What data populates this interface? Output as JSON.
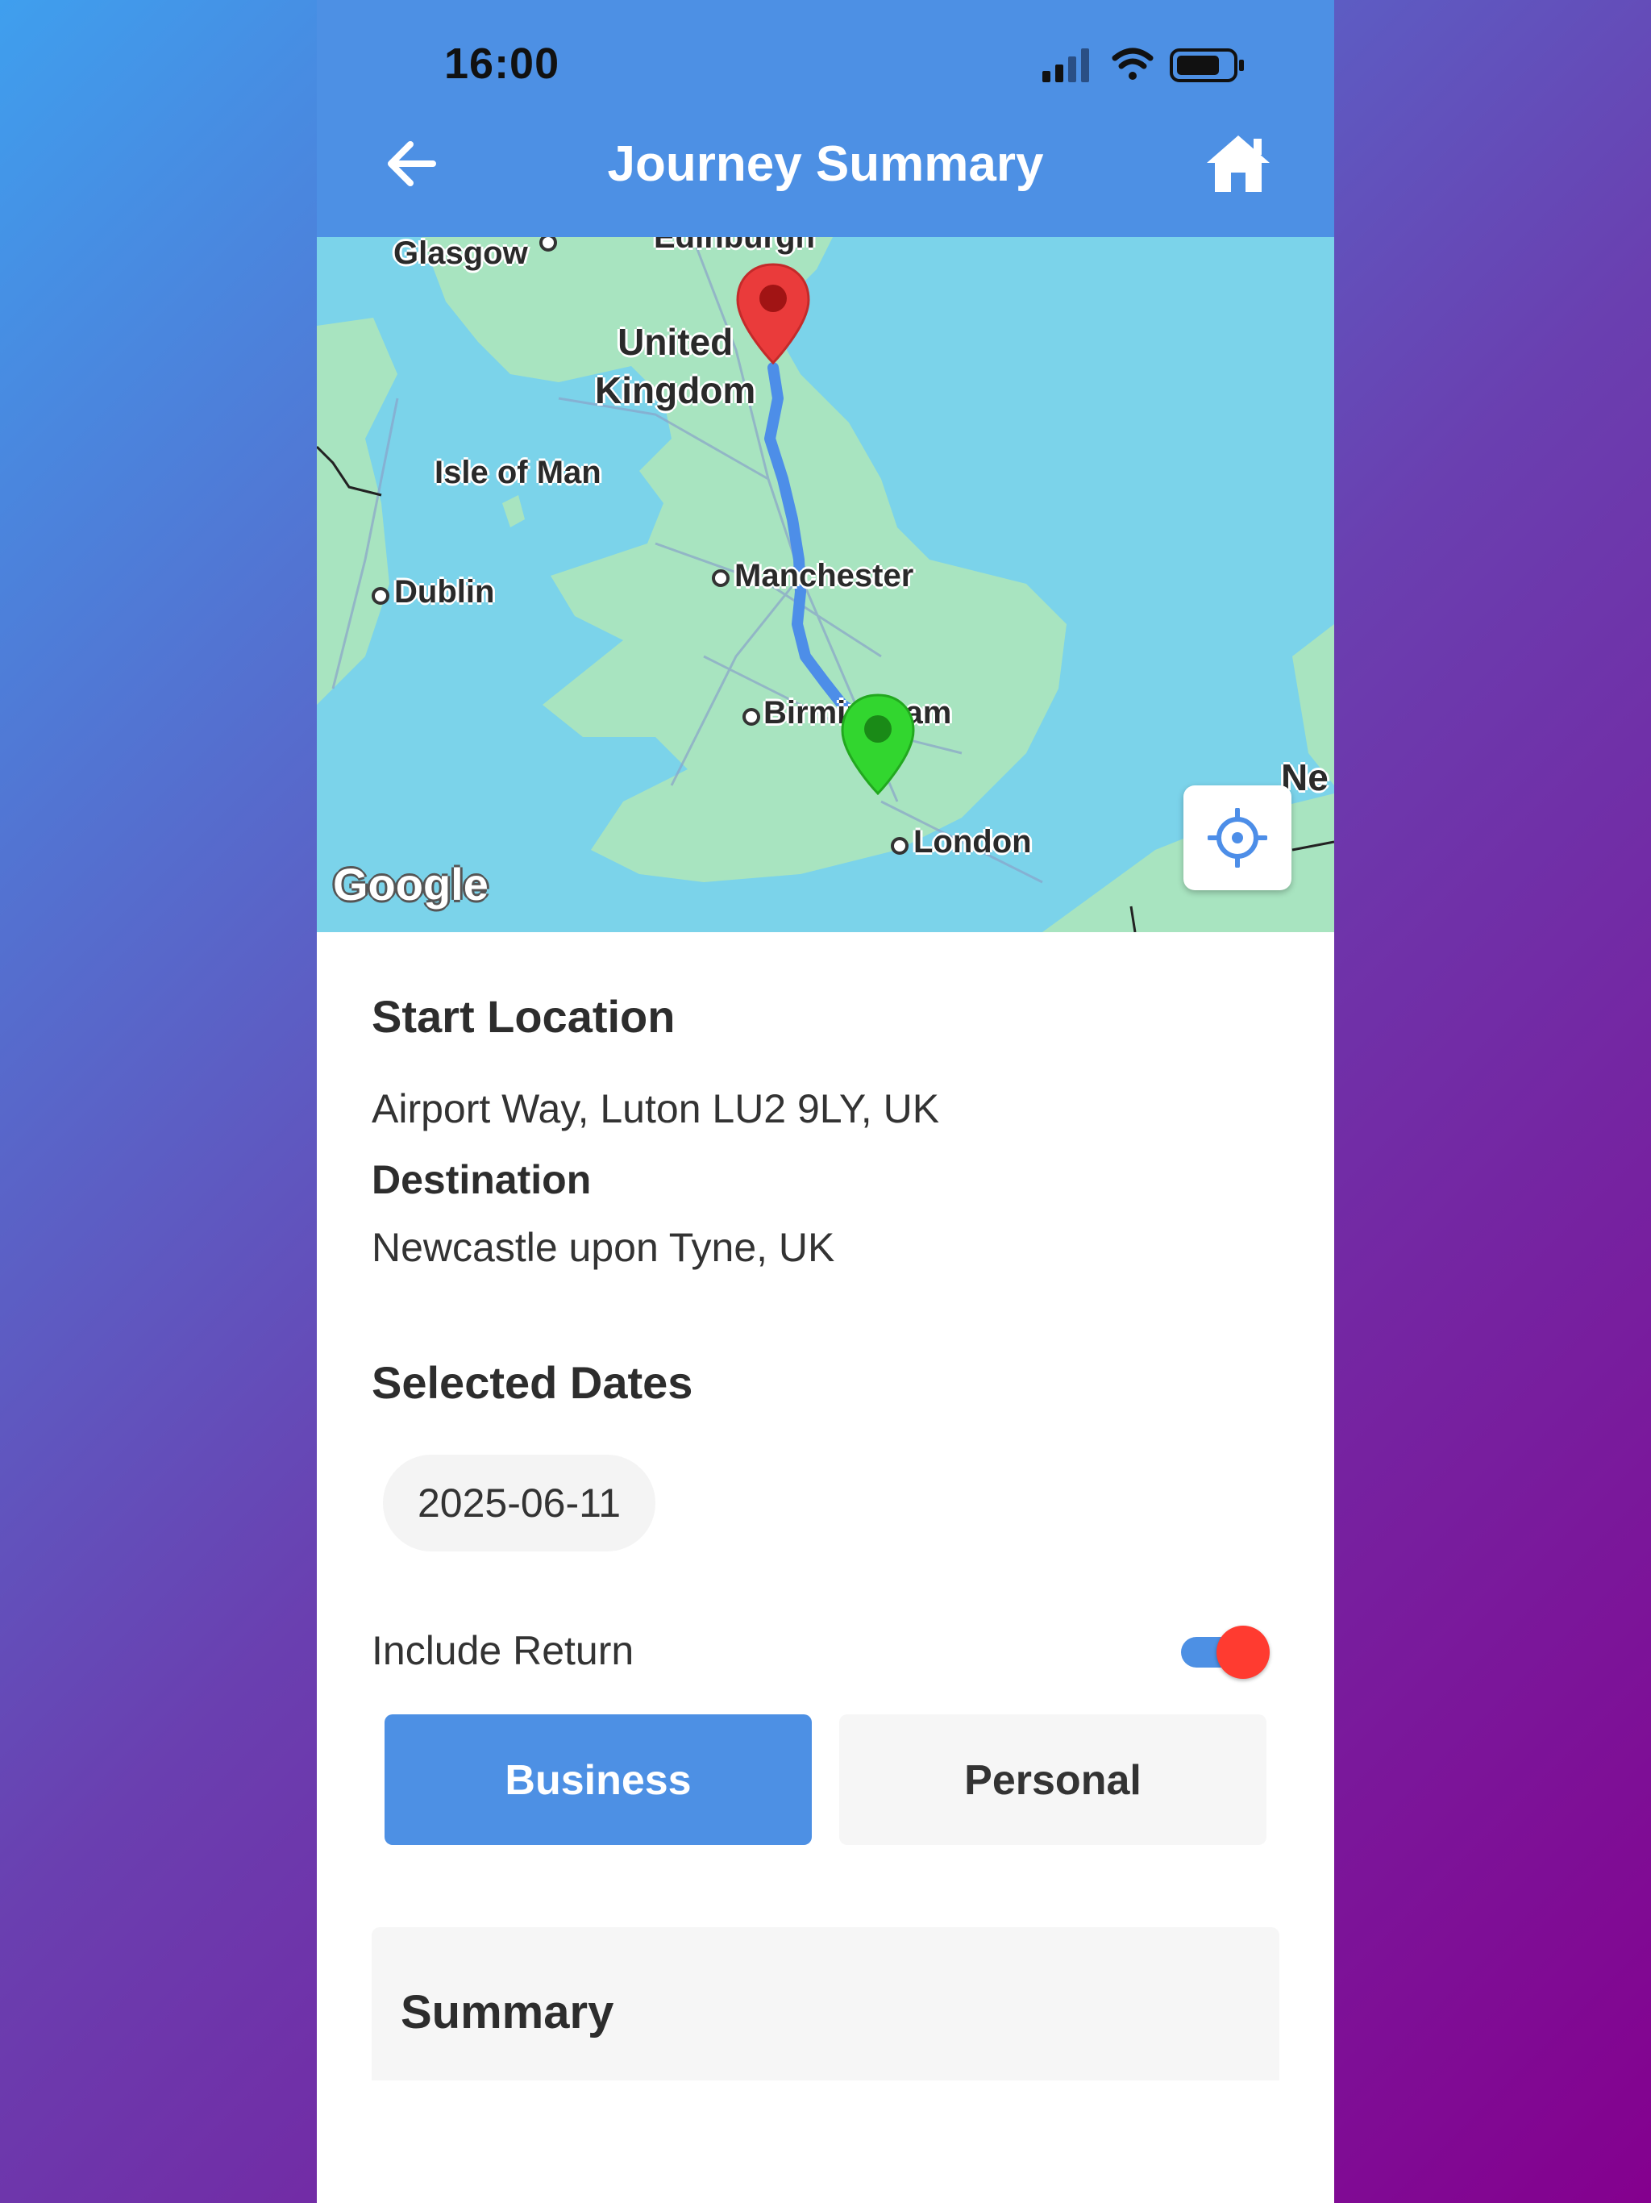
{
  "status_bar": {
    "time": "16:00"
  },
  "header": {
    "title": "Journey Summary",
    "back_icon": "arrow-left-icon",
    "home_icon": "home-icon"
  },
  "map": {
    "labels": {
      "glasgow": "Glasgow",
      "edinburgh": "Edinburgh",
      "uk_line1": "United",
      "uk_line2": "Kingdom",
      "isle_of_man": "Isle of Man",
      "dublin": "Dublin",
      "manchester": "Manchester",
      "birmingham": "Birmingham",
      "london": "London",
      "netherlands_partial": "Ne"
    },
    "logo": "Google",
    "colors": {
      "water": "#7bd3ea",
      "land": "#a8e4c0",
      "route": "#4d8ee8",
      "destination_pin": "#ea3b3b",
      "start_pin": "#32d62f"
    }
  },
  "journey": {
    "start_heading": "Start Location",
    "start_value": "Airport Way, Luton LU2 9LY, UK",
    "destination_heading": "Destination",
    "destination_value": "Newcastle upon Tyne, UK",
    "dates_heading": "Selected Dates",
    "dates": [
      "2025-06-11"
    ],
    "include_return_label": "Include Return",
    "include_return": true,
    "trip_types": [
      "Business",
      "Personal"
    ],
    "selected_trip_type": "Business",
    "summary_heading": "Summary"
  },
  "colors": {
    "primary": "#4d90e4",
    "toggle_knob": "#ff3b30"
  }
}
